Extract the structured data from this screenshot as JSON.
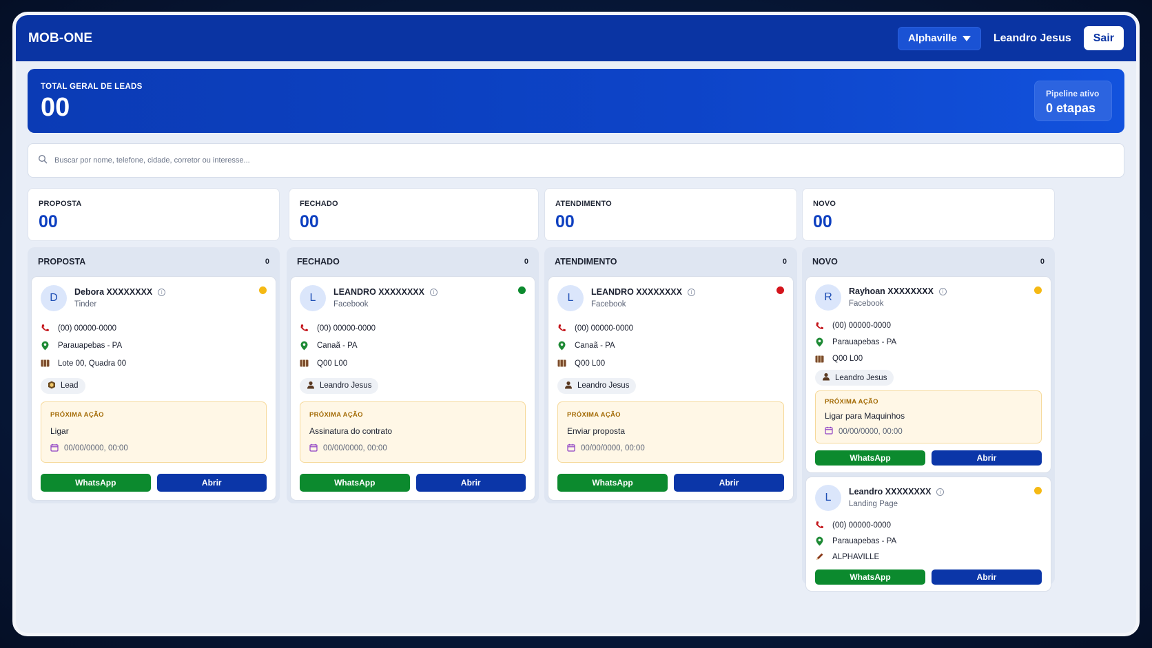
{
  "header": {
    "brand": "MOB-ONE",
    "city": "Alphaville",
    "user": "Leandro Jesus",
    "logout": "Sair"
  },
  "hero": {
    "label": "TOTAL GERAL DE LEADS",
    "value": "00",
    "pipeline_label": "Pipeline ativo",
    "pipeline_value": "0 etapas"
  },
  "search": {
    "placeholder": "Buscar por nome, telefone, cidade, corretor ou interesse..."
  },
  "stats": [
    {
      "label": "PROPOSTA",
      "value": "00"
    },
    {
      "label": "FECHADO",
      "value": "00"
    },
    {
      "label": "ATENDIMENTO",
      "value": "00"
    },
    {
      "label": "NOVO",
      "value": "00"
    }
  ],
  "columns": [
    {
      "title": "PROPOSTA",
      "count": "0"
    },
    {
      "title": "FECHADO",
      "count": "0"
    },
    {
      "title": "ATENDIMENTO",
      "count": "0"
    },
    {
      "title": "NOVO",
      "count": "0"
    }
  ],
  "leads": [
    {
      "initial": "D",
      "name": "Debora XXXXXXXX",
      "source": "Tinder",
      "status_color": "#f5b914",
      "phone": "(00) 00000-0000",
      "city": "Parauapebas - PA",
      "address": "Lote 00, Quadra 00",
      "tag": "Lead",
      "next_label": "PRÓXIMA AÇÃO",
      "next_action": "Ligar",
      "next_date": "00/00/0000, 00:00",
      "whatsapp": "WhatsApp",
      "open": "Abrir"
    },
    {
      "initial": "L",
      "name": "LEANDRO XXXXXXXX",
      "source": "Facebook",
      "status_color": "#0c8a2e",
      "phone": "(00) 00000-0000",
      "city": "Canaã - PA",
      "address": "Q00 L00",
      "tag": "Leandro Jesus",
      "next_label": "PRÓXIMA AÇÃO",
      "next_action": "Assinatura do contrato",
      "next_date": "00/00/0000, 00:00",
      "whatsapp": "WhatsApp",
      "open": "Abrir"
    },
    {
      "initial": "L",
      "name": "LEANDRO XXXXXXXX",
      "source": "Facebook",
      "status_color": "#d4141c",
      "phone": "(00) 00000-0000",
      "city": "Canaã - PA",
      "address": "Q00 L00",
      "tag": "Leandro Jesus",
      "next_label": "PRÓXIMA AÇÃO",
      "next_action": "Enviar proposta",
      "next_date": "00/00/0000, 00:00",
      "whatsapp": "WhatsApp",
      "open": "Abrir"
    },
    {
      "initial": "R",
      "name": "Rayhoan XXXXXXXX",
      "source": "Facebook",
      "status_color": "#f5b914",
      "phone": "(00) 00000-0000",
      "city": "Parauapebas - PA",
      "address": "Q00 L00",
      "tag": "Leandro Jesus",
      "next_label": "PRÓXIMA AÇÃO",
      "next_action": "Ligar para Maquinhos",
      "next_date": "00/00/0000, 00:00",
      "whatsapp": "WhatsApp",
      "open": "Abrir"
    },
    {
      "initial": "L",
      "name": "Leandro XXXXXXXX",
      "source": "Landing Page",
      "status_color": "#f5b914",
      "phone": "(00) 00000-0000",
      "city": "Parauapebas - PA",
      "interest": "ALPHAVILLE",
      "whatsapp": "WhatsApp",
      "open": "Abrir"
    }
  ]
}
